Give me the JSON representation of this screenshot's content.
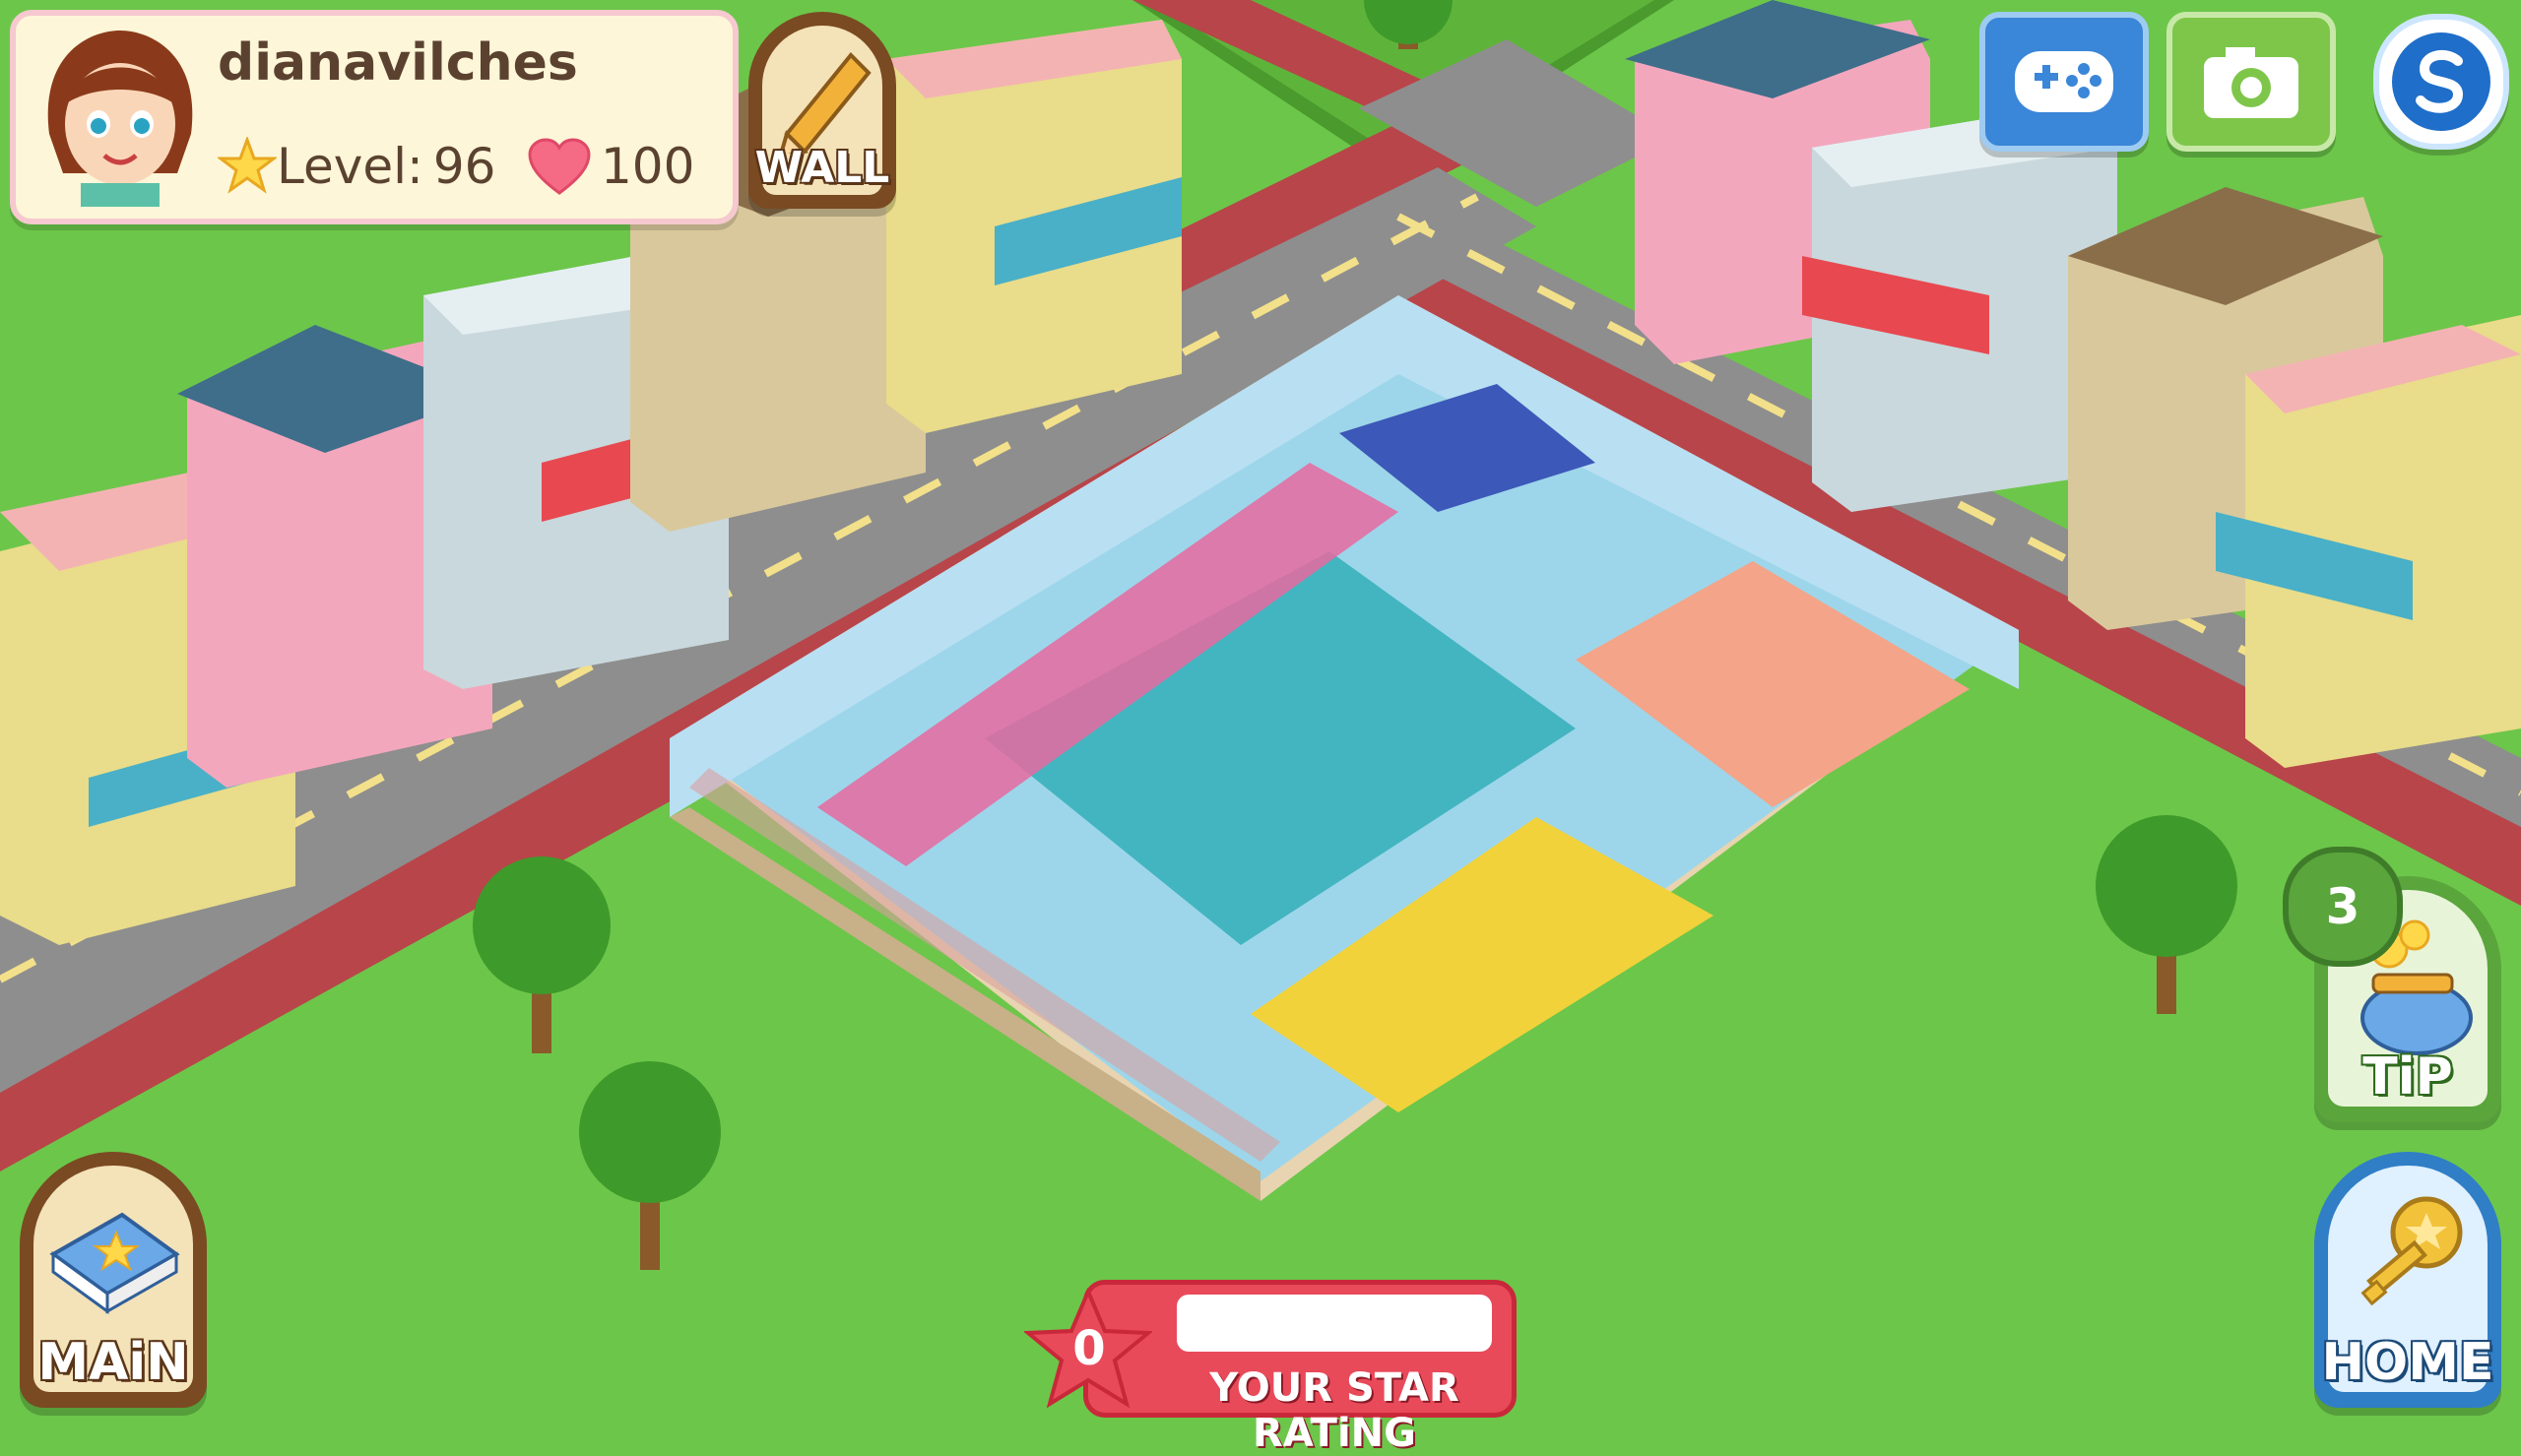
{
  "player": {
    "username": "dianavilches",
    "level_label": "Level:",
    "level_value": "96",
    "hearts_value": "100"
  },
  "buttons": {
    "wall_label": "WALL",
    "main_label": "MAiN",
    "tip_label": "TiP",
    "home_label": "HOME",
    "tip_count": "3"
  },
  "star_rating": {
    "value": "0",
    "label": "YOUR STAR RATiNG",
    "progress_fraction": 0
  },
  "icons": {
    "avatar": "player-avatar",
    "level": "star-icon",
    "hearts": "heart-icon",
    "wall": "pencil-icon",
    "main": "recipe-book-icon",
    "tip": "coin-purse-icon",
    "home": "key-icon",
    "game": "game-controller-icon",
    "camera": "camera-icon",
    "social": "social-s-icon"
  },
  "colors": {
    "grass": "#6cc64a",
    "road": "#8a8a8a",
    "sidewalk": "#b8454a",
    "floor": "#9dd6ea",
    "profile_bg": "#fdf6d8",
    "rating_red": "#e84a5a"
  }
}
